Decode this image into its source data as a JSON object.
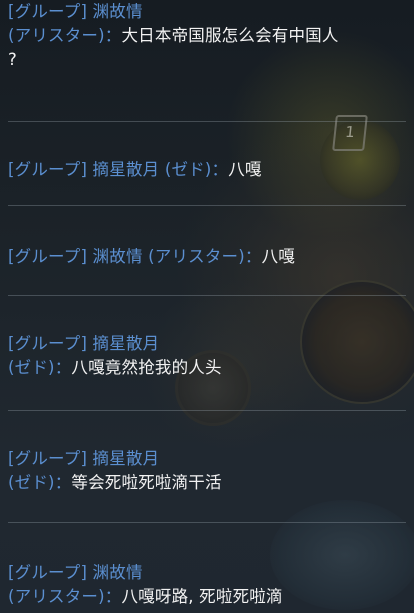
{
  "messages": [
    {
      "channel": "[グループ]",
      "sender": "渊故情",
      "champion": "(アリスター)",
      "separator": "：",
      "text": "大日本帝国服怎么会有中国人",
      "text_cont": "?"
    },
    {
      "channel": "[グループ]",
      "sender": "摘星散月",
      "champion": "(ゼド)",
      "separator": "：",
      "text": "八嘎"
    },
    {
      "channel": "[グループ]",
      "sender": "渊故情",
      "champion": "(アリスター)",
      "separator": "：",
      "text": "八嘎"
    },
    {
      "channel": "[グループ]",
      "sender": "摘星散月",
      "champion": "(ゼド)",
      "separator": "：",
      "text": "八嘎竟然抢我的人头"
    },
    {
      "channel": "[グループ]",
      "sender": "摘星散月",
      "champion": "(ゼド)",
      "separator": "：",
      "text": "等会死啦死啦滴干活"
    },
    {
      "channel": "[グループ]",
      "sender": "渊故情",
      "champion": "(アリスター)",
      "separator": "：",
      "text": "八嘎呀路, 死啦死啦滴"
    }
  ],
  "background": {
    "badge_number": "1"
  },
  "colors": {
    "label": "#5b8fd0",
    "text": "#f2f2f2",
    "separator": "rgba(150,160,170,0.35)"
  }
}
